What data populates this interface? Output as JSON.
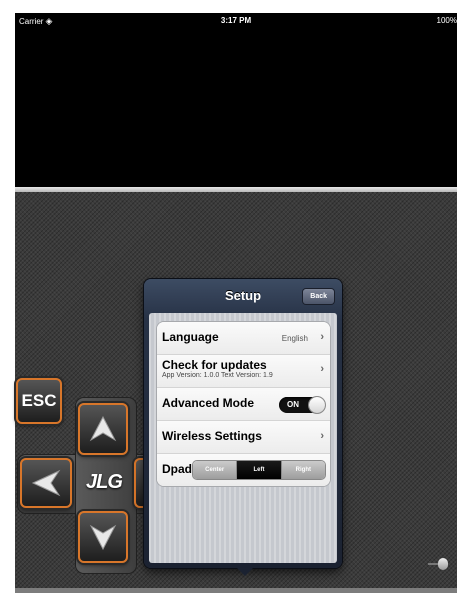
{
  "status_bar": {
    "carrier": "Carrier",
    "wifi_icon": "wifi-icon",
    "time": "3:17 PM",
    "battery": "100%"
  },
  "controls": {
    "esc_label": "ESC",
    "logo_text": "JLG",
    "icons": [
      "arrow-up-icon",
      "arrow-left-icon",
      "arrow-down-icon",
      "plug-icon"
    ],
    "accent_color": "#d8762a"
  },
  "setup": {
    "title": "Setup",
    "back_label": "Back",
    "language": {
      "label": "Language",
      "value": "English"
    },
    "updates": {
      "label": "Check for updates",
      "subtitle": "App Version: 1.0.0  Text Version: 1.9"
    },
    "advanced_mode": {
      "label": "Advanced Mode",
      "state": "ON"
    },
    "wireless": {
      "label": "Wireless Settings"
    },
    "dpad": {
      "label": "Dpad",
      "options": [
        "Center",
        "Left",
        "Right"
      ],
      "selected": "Left"
    }
  }
}
